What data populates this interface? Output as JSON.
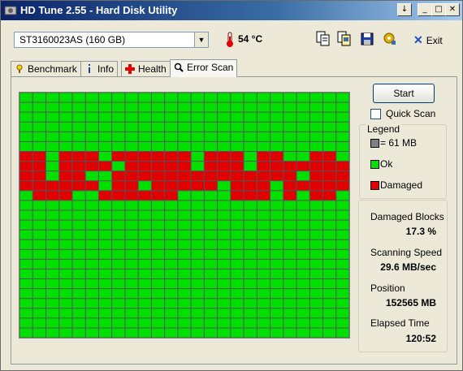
{
  "window": {
    "title": "HD Tune 2.55 - Hard Disk Utility",
    "controls": [
      "help",
      "minimize",
      "maximize",
      "close"
    ]
  },
  "toolbar": {
    "drive": "ST3160023AS (160 GB)",
    "temperature": "54 °C",
    "icons": [
      "copy-text-icon",
      "copy-screenshot-icon",
      "save-icon",
      "options-icon"
    ],
    "exit_label": "Exit"
  },
  "tabs": [
    {
      "label": "Benchmark",
      "icon": "benchmark-icon",
      "active": false
    },
    {
      "label": "Info",
      "icon": "info-icon",
      "active": false
    },
    {
      "label": "Health",
      "icon": "health-icon",
      "active": false
    },
    {
      "label": "Error Scan",
      "icon": "error-scan-icon",
      "active": true
    }
  ],
  "scan": {
    "columns": 25,
    "rows": 25,
    "colors": {
      "ok": "#00e000",
      "damaged": "#e00000",
      "unscanned": "#808080"
    },
    "damaged_rows_start": 6,
    "damaged_rows_end": 10
  },
  "controls": {
    "start_label": "Start",
    "quick_scan_label": "Quick Scan",
    "quick_scan_checked": false
  },
  "legend": {
    "title": "Legend",
    "items": [
      {
        "label": "= 61 MB",
        "color": "#808080"
      },
      {
        "label": "Ok",
        "color": "#00e000"
      },
      {
        "label": "Damaged",
        "color": "#e00000"
      }
    ]
  },
  "stats": {
    "damaged_blocks_label": "Damaged Blocks",
    "damaged_blocks_value": "17.3 %",
    "scanning_speed_label": "Scanning Speed",
    "scanning_speed_value": "29.6 MB/sec",
    "position_label": "Position",
    "position_value": "152565 MB",
    "elapsed_label": "Elapsed Time",
    "elapsed_value": "120:52"
  }
}
